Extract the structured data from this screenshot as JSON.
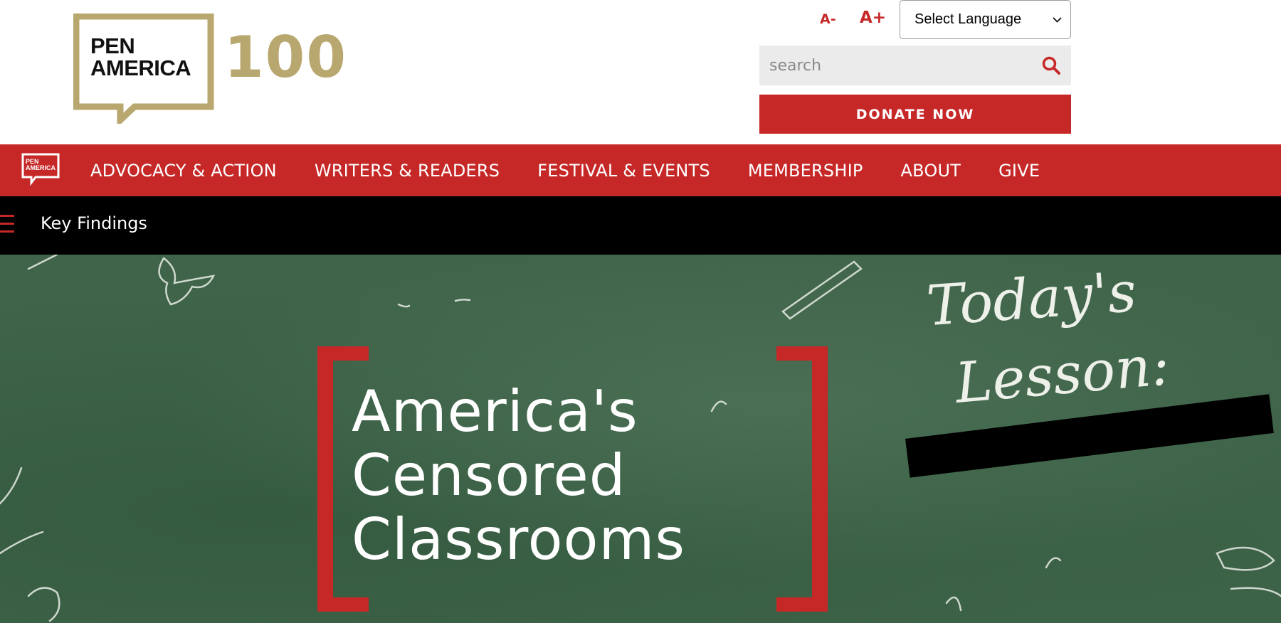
{
  "header": {
    "logo_line1": "PEN",
    "logo_line2": "AMERICA",
    "logo_number": "100",
    "font_decrease": "A-",
    "font_increase": "A+",
    "language_select": "Select Language",
    "search_placeholder": "search",
    "donate_label": "DONATE NOW"
  },
  "nav": {
    "logo_line1": "PEN",
    "logo_line2": "AMERICA",
    "items": [
      {
        "label": "ADVOCACY & ACTION"
      },
      {
        "label": "WRITERS & READERS"
      },
      {
        "label": "FESTIVAL & EVENTS"
      },
      {
        "label": "MEMBERSHIP"
      },
      {
        "label": "ABOUT"
      },
      {
        "label": "GIVE"
      }
    ]
  },
  "subbar": {
    "label": "Key Findings"
  },
  "hero": {
    "title_line1": "America's",
    "title_line2": "Censored",
    "title_line3": "Classrooms",
    "chalk_line1": "Today's",
    "chalk_line2": "Lesson:"
  },
  "colors": {
    "brand_red": "#c62828",
    "gold": "#b8a76f",
    "chalkboard_green": "#3f6449"
  }
}
